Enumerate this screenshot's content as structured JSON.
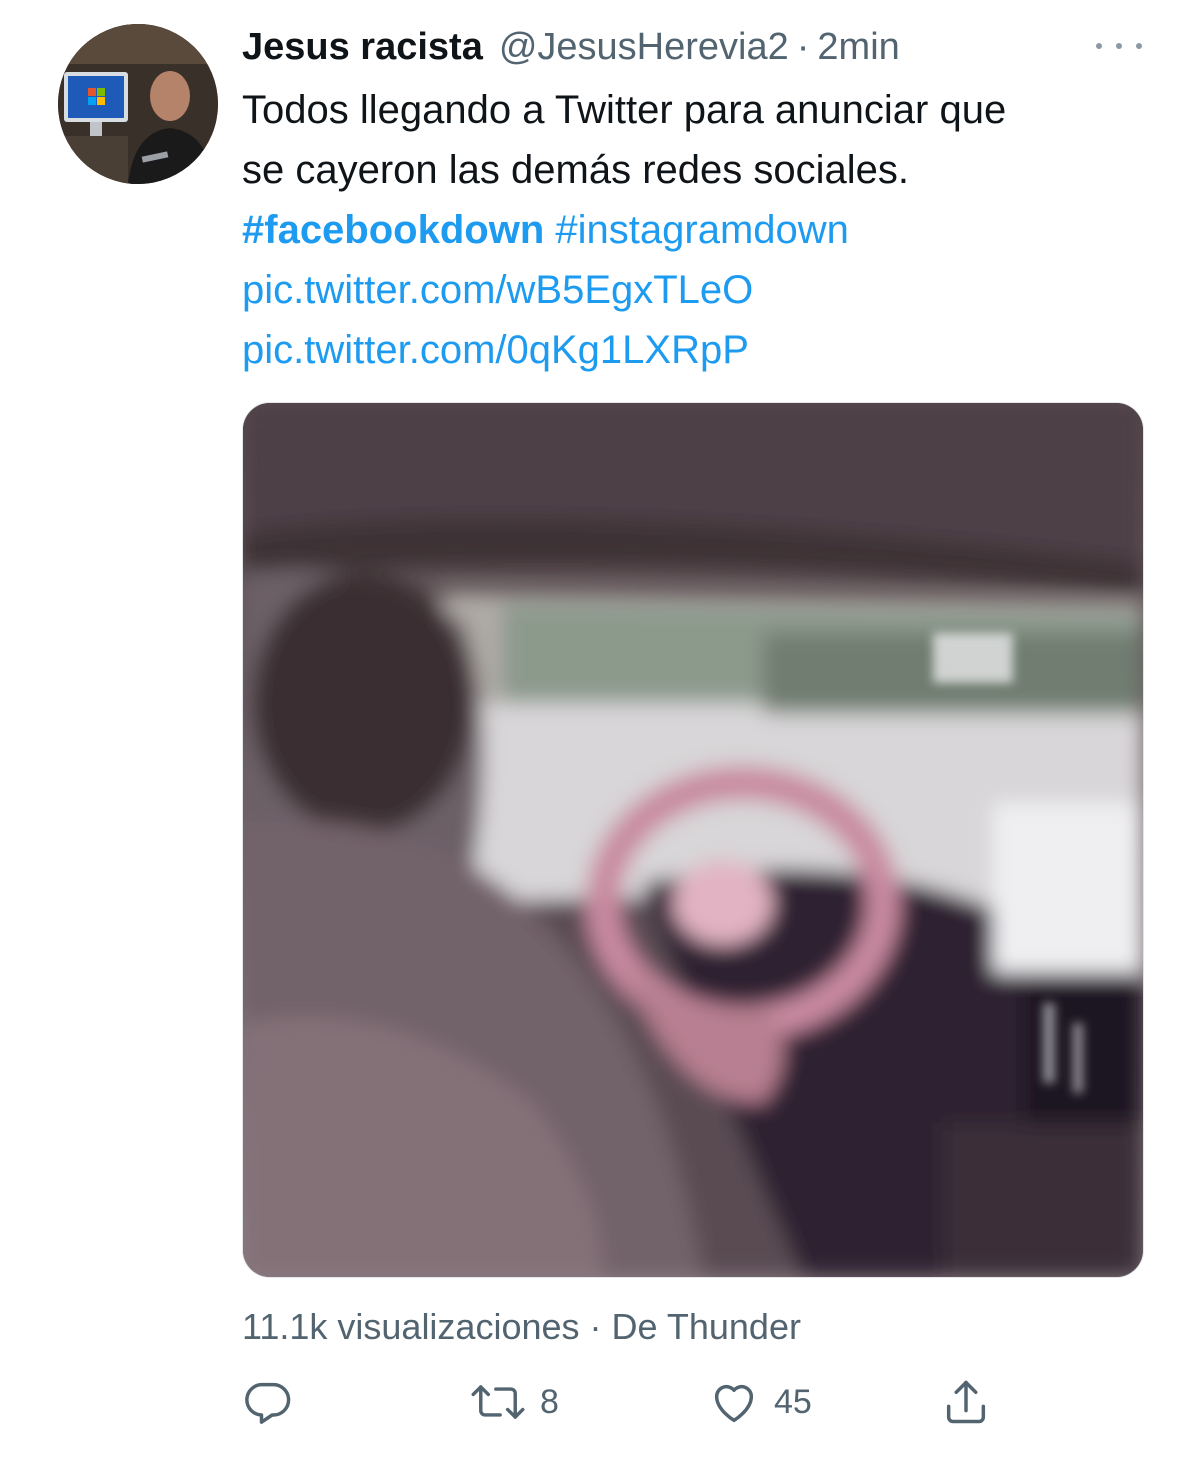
{
  "author": {
    "name": "Jesus racista",
    "handle": "@JesusHerevia2",
    "separator": "·",
    "time": "2min"
  },
  "tweet": {
    "line1": "Todos llegando a Twitter para anunciar que",
    "line2": "se cayeron las demás redes sociales.",
    "hashtags": [
      "#facebookdown",
      "#instagramdown"
    ],
    "links": [
      "pic.twitter.com/wB5EgxTLeO",
      "pic.twitter.com/0qKg1LXRpP"
    ]
  },
  "media": {
    "views_text": "11.1k visualizaciones · De Thunder"
  },
  "actions": {
    "reply_icon": "reply-icon",
    "retweet_icon": "retweet-icon",
    "retweet_count": "8",
    "like_icon": "heart-icon",
    "like_count": "45",
    "share_icon": "share-icon"
  },
  "colors": {
    "link": "#1d9bf0",
    "secondary_text": "#536471",
    "primary_text": "#0f1419"
  }
}
